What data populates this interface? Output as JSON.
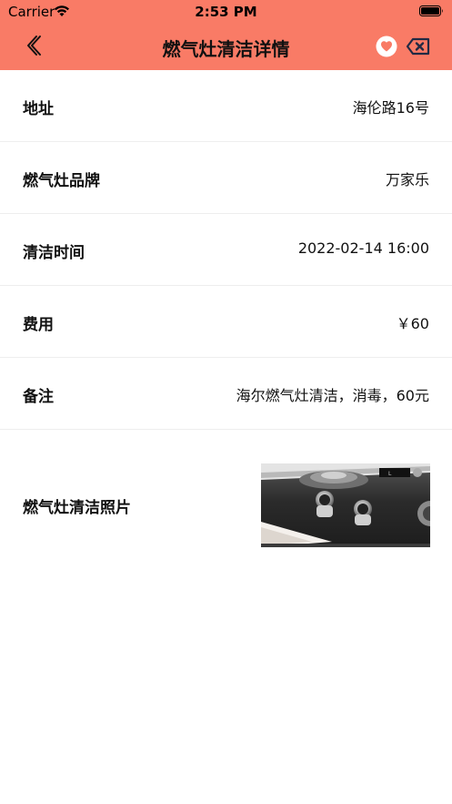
{
  "status_bar": {
    "carrier": "Carrier",
    "time": "2:53 PM"
  },
  "nav": {
    "title": "燃气灶清洁详情",
    "back_icon": "chevron-left-icon",
    "favorite_icon": "heart-icon",
    "delete_icon": "backspace-delete-icon"
  },
  "details": [
    {
      "label": "地址",
      "value": "海伦路16号"
    },
    {
      "label": "燃气灶品牌",
      "value": "万家乐"
    },
    {
      "label": "清洁时间",
      "value": "2022-02-14 16:00"
    },
    {
      "label": "费用",
      "value": "￥60"
    },
    {
      "label": "备注",
      "value": "海尔燃气灶清洁，消毒，60元"
    }
  ],
  "photo_section": {
    "label": "燃气灶清洁照片"
  },
  "colors": {
    "header": "#f97b66",
    "background": "#ffffff",
    "divider": "#eeeeee",
    "text": "#111111"
  }
}
